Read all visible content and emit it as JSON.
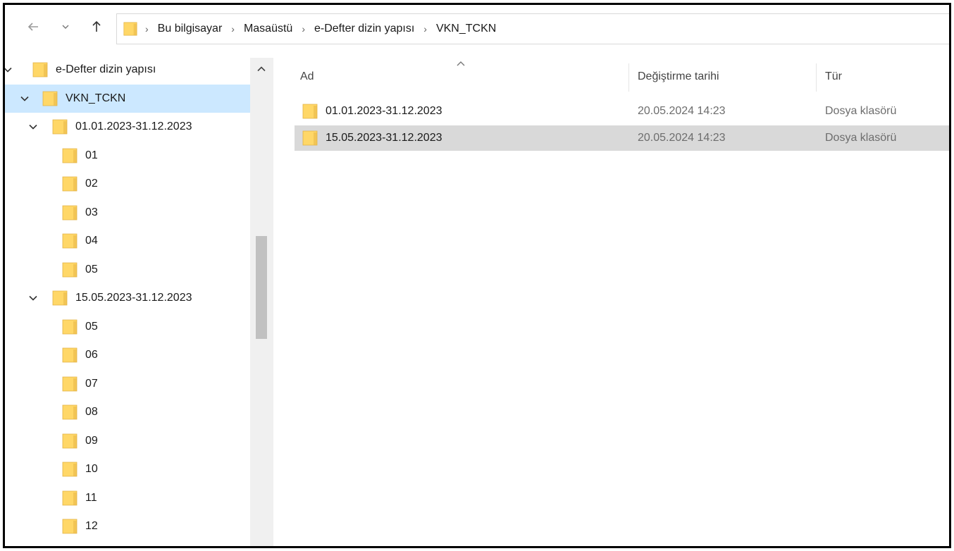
{
  "address_bar": {
    "crumbs": [
      "Bu bilgisayar",
      "Masaüstü",
      "e-Defter dizin yapısı",
      "VKN_TCKN"
    ],
    "separator": "›"
  },
  "nav_tree": [
    {
      "label": "e-Defter dizin yapısı",
      "level": 0,
      "expanded": true,
      "selected": false
    },
    {
      "label": "VKN_TCKN",
      "level": 1,
      "expanded": true,
      "selected": true
    },
    {
      "label": "01.01.2023-31.12.2023",
      "level": 2,
      "expanded": true,
      "selected": false
    },
    {
      "label": "01",
      "level": 3,
      "expanded": false,
      "selected": false
    },
    {
      "label": "02",
      "level": 3,
      "expanded": false,
      "selected": false
    },
    {
      "label": "03",
      "level": 3,
      "expanded": false,
      "selected": false
    },
    {
      "label": "04",
      "level": 3,
      "expanded": false,
      "selected": false
    },
    {
      "label": "05",
      "level": 3,
      "expanded": false,
      "selected": false
    },
    {
      "label": "15.05.2023-31.12.2023",
      "level": 2,
      "expanded": true,
      "selected": false
    },
    {
      "label": "05",
      "level": 3,
      "expanded": false,
      "selected": false
    },
    {
      "label": "06",
      "level": 3,
      "expanded": false,
      "selected": false
    },
    {
      "label": "07",
      "level": 3,
      "expanded": false,
      "selected": false
    },
    {
      "label": "08",
      "level": 3,
      "expanded": false,
      "selected": false
    },
    {
      "label": "09",
      "level": 3,
      "expanded": false,
      "selected": false
    },
    {
      "label": "10",
      "level": 3,
      "expanded": false,
      "selected": false
    },
    {
      "label": "11",
      "level": 3,
      "expanded": false,
      "selected": false
    },
    {
      "label": "12",
      "level": 3,
      "expanded": false,
      "selected": false
    }
  ],
  "file_list": {
    "columns": {
      "name": "Ad",
      "modified": "Değiştirme tarihi",
      "type": "Tür"
    },
    "rows": [
      {
        "name": "01.01.2023-31.12.2023",
        "modified": "20.05.2024 14:23",
        "type": "Dosya klasörü",
        "selected": false
      },
      {
        "name": "15.05.2023-31.12.2023",
        "modified": "20.05.2024 14:23",
        "type": "Dosya klasörü",
        "selected": true
      }
    ]
  },
  "colors": {
    "folder": "#ffd767",
    "folder_shade": "#e8b647",
    "nav_selected": "#cce8ff",
    "row_selected": "#d9d9d9"
  },
  "icons": {
    "folder": "folder-icon",
    "chevron": "chevron-down-icon",
    "back": "arrow-left-icon",
    "up": "arrow-up-icon"
  }
}
